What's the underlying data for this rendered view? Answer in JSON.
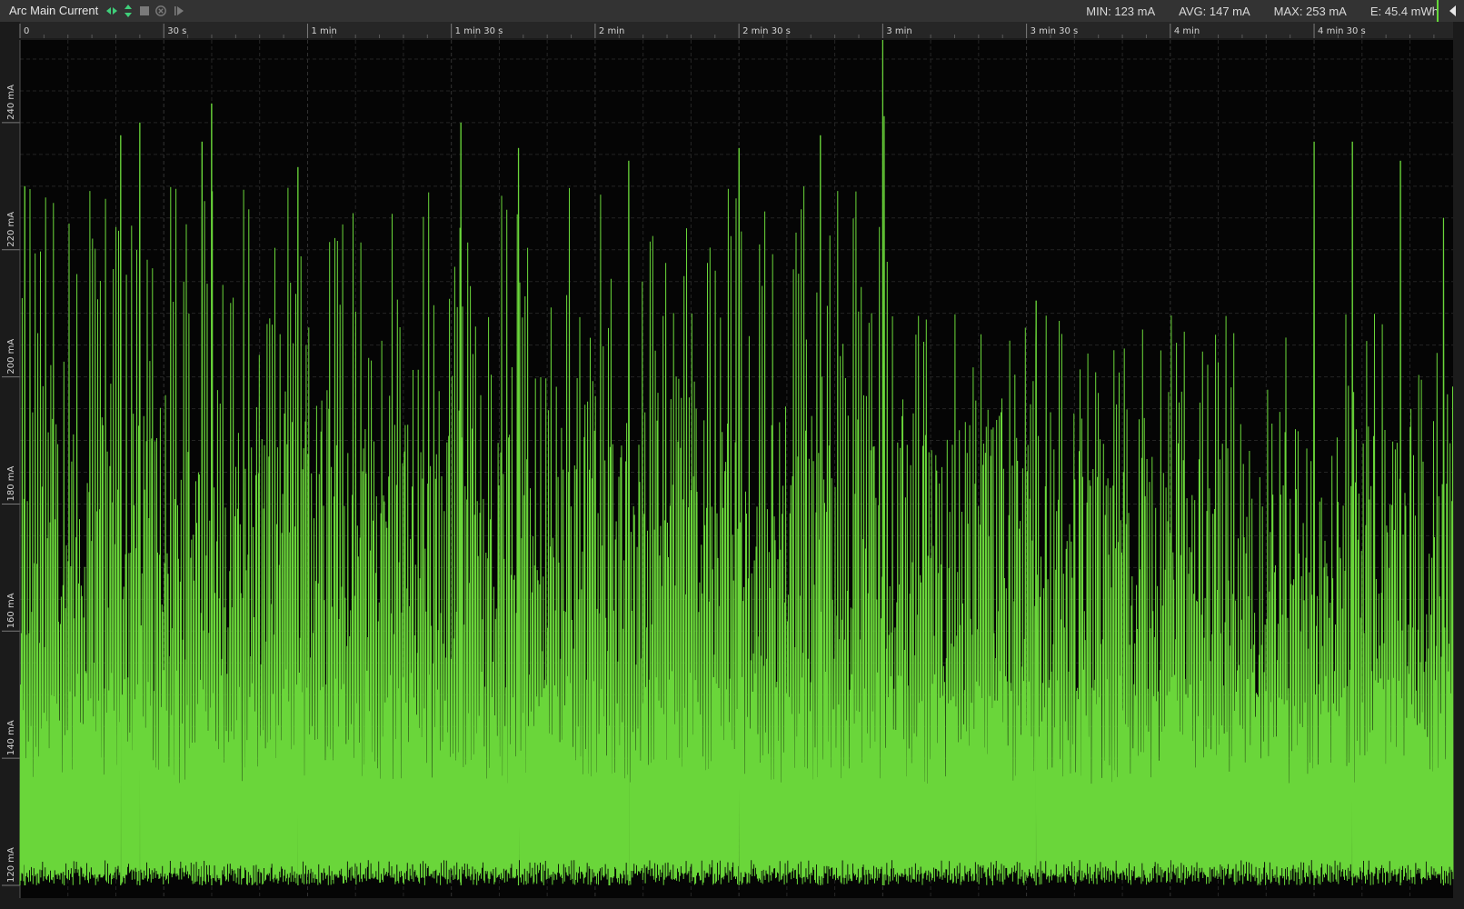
{
  "toolbar": {
    "title": "Arc Main Current",
    "icons": [
      "horizontal-arrows-icon",
      "vertical-arrows-icon",
      "stop-icon",
      "close-circle-icon",
      "step-forward-icon",
      "collapse-icon"
    ]
  },
  "stats": {
    "min": "MIN: 123 mA",
    "avg": "AVG: 147 mA",
    "max": "MAX: 253 mA",
    "energy": "E: 45.4 mWh"
  },
  "colors": {
    "trace": "#6ad63a",
    "background": "#050505",
    "accent": "#65d83a"
  },
  "chart_data": {
    "type": "line",
    "title": "Arc Main Current",
    "xlabel": "",
    "ylabel": "",
    "x_unit": "s",
    "y_unit": "mA",
    "xlim": [
      0,
      299
    ],
    "ylim": [
      118,
      253
    ],
    "x_ticks": [
      {
        "value": 0,
        "label": "0"
      },
      {
        "value": 30,
        "label": "30 s"
      },
      {
        "value": 60,
        "label": "1 min"
      },
      {
        "value": 90,
        "label": "1 min 30 s"
      },
      {
        "value": 120,
        "label": "2 min"
      },
      {
        "value": 150,
        "label": "2 min 30 s"
      },
      {
        "value": 180,
        "label": "3 min"
      },
      {
        "value": 210,
        "label": "3 min 30 s"
      },
      {
        "value": 240,
        "label": "4 min"
      },
      {
        "value": 270,
        "label": "4 min 30 s"
      }
    ],
    "y_ticks": [
      {
        "value": 120,
        "label": "120 mA"
      },
      {
        "value": 140,
        "label": "140 mA"
      },
      {
        "value": 160,
        "label": "160 mA"
      },
      {
        "value": 180,
        "label": "180 mA"
      },
      {
        "value": 200,
        "label": "200 mA"
      },
      {
        "value": 220,
        "label": "220 mA"
      },
      {
        "value": 240,
        "label": "240 mA"
      }
    ],
    "grid": true,
    "legend": "none",
    "series": [
      {
        "baseline_mA": 120,
        "min_mA": 123,
        "avg_mA": 147,
        "max_mA": 253,
        "peaks": [
          {
            "t": 1,
            "v": 230
          },
          {
            "t": 21,
            "v": 238
          },
          {
            "t": 25,
            "v": 240
          },
          {
            "t": 38,
            "v": 237
          },
          {
            "t": 40,
            "v": 243
          },
          {
            "t": 58,
            "v": 233
          },
          {
            "t": 92,
            "v": 240
          },
          {
            "t": 104,
            "v": 236
          },
          {
            "t": 127,
            "v": 234
          },
          {
            "t": 150,
            "v": 236
          },
          {
            "t": 167,
            "v": 238
          },
          {
            "t": 180,
            "v": 253
          },
          {
            "t": 180.3,
            "v": 241
          },
          {
            "t": 212,
            "v": 212
          },
          {
            "t": 270,
            "v": 237
          },
          {
            "t": 278,
            "v": 237
          },
          {
            "t": 288,
            "v": 234
          },
          {
            "t": 297,
            "v": 225
          }
        ]
      }
    ]
  }
}
